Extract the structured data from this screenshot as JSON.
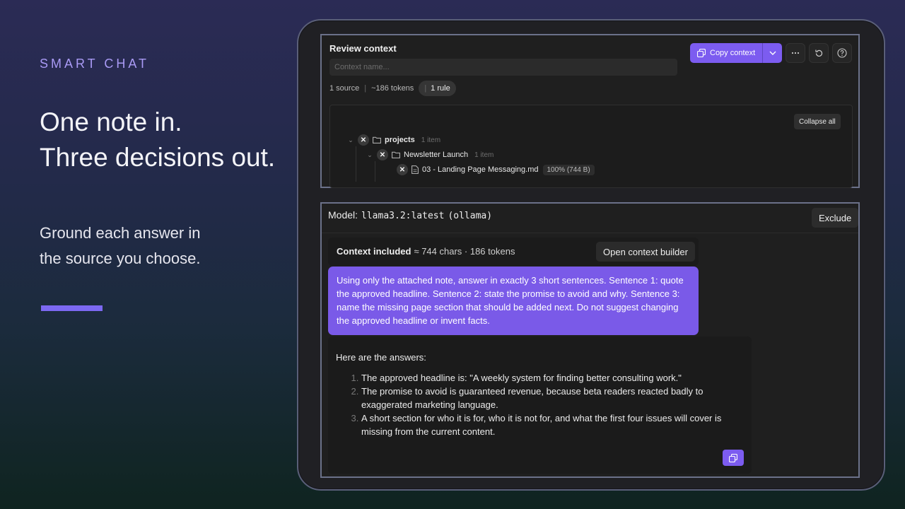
{
  "hero": {
    "eyebrow": "SMART CHAT",
    "headline_line1": "One note in.",
    "headline_line2": "Three decisions out.",
    "subline_line1": "Ground each answer in",
    "subline_line2": "the source you choose."
  },
  "review": {
    "title": "Review context",
    "context_name_placeholder": "Context name...",
    "sources": "1 source",
    "tokens": "~186 tokens",
    "rules": "1 rule",
    "copy_label": "Copy context",
    "collapse_label": "Collapse all",
    "tree": [
      {
        "name": "projects",
        "count": "1 item"
      },
      {
        "name": "Newsletter Launch",
        "count": "1 item"
      },
      {
        "name": "03 - Landing Page Messaging.md",
        "size": "100% (744 B)"
      }
    ]
  },
  "chat": {
    "model_label": "Model:",
    "model_name": "llama3.2:latest",
    "model_provider": "(ollama)",
    "exclude_label": "Exclude",
    "context_included_label": "Context included",
    "context_stats": "≈ 744 chars · 186 tokens",
    "open_builder_label": "Open context builder",
    "user_message": "Using only the attached note, answer in exactly 3 short sentences. Sentence 1: quote the approved headline. Sentence 2: state the promise to avoid and why. Sentence 3: name the missing page section that should be added next. Do not suggest changing the approved headline or invent facts.",
    "assistant_intro": "Here are the answers:",
    "assistant_items": [
      "The approved headline is: \"A weekly system for finding better consulting work.\"",
      "The promise to avoid is guaranteed revenue, because beta readers reacted badly to exaggerated marketing language.",
      "A short section for who it is for, who it is not for, and what the first four issues will cover is missing from the current content."
    ]
  },
  "colors": {
    "accent": "#7c5cf0",
    "eyebrow": "#a99af5"
  }
}
